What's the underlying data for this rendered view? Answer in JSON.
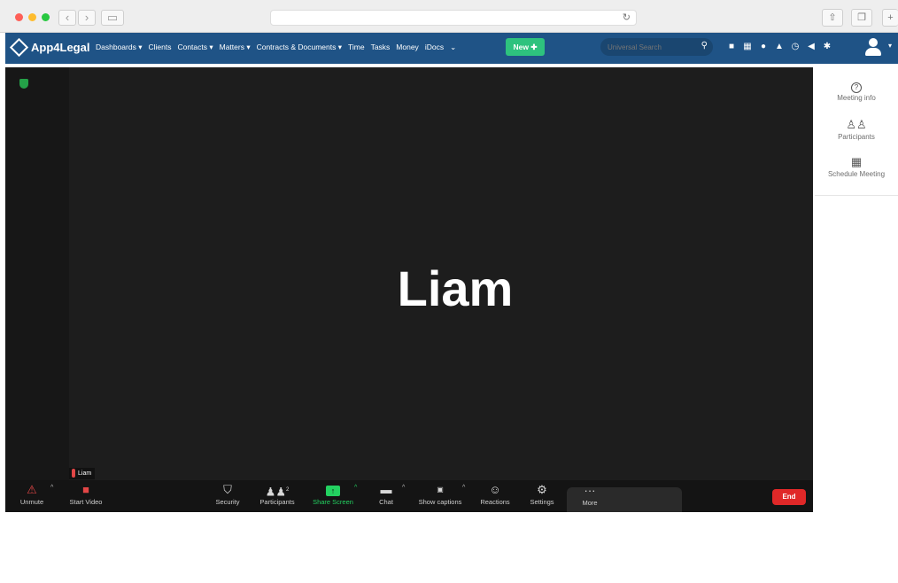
{
  "browser": {
    "icons": {
      "back": "chevron-left-icon",
      "forward": "chevron-right-icon",
      "sidebar": "sidebar-icon",
      "reload": "reload-icon",
      "share": "share-icon",
      "tabs": "tabs-icon",
      "new_tab": "plus-icon"
    }
  },
  "app": {
    "logo_text": "App4Legal",
    "menu": [
      "Dashboards ▾",
      "Clients",
      "Contacts ▾",
      "Matters ▾",
      "Contracts & Documents ▾",
      "Time",
      "Tasks",
      "Money",
      "iDocs",
      "⌄"
    ],
    "new_button": "New ✚",
    "search_placeholder": "Universal Search",
    "brand_color": "#1f5386",
    "accent_color": "#2ec27e"
  },
  "meeting": {
    "participant_name": "Liam",
    "name_tag": "Liam",
    "toolbar": {
      "unmute": "Unmute",
      "start_video": "Start Video",
      "security": "Security",
      "participants": "Participants",
      "participant_count": "2",
      "share_screen": "Share Screen",
      "chat": "Chat",
      "show_captions": "Show captions",
      "reactions": "Reactions",
      "settings": "Settings",
      "more": "More",
      "end": "End"
    },
    "end_color": "#e02828",
    "share_color": "#23d160"
  },
  "right_panel": {
    "meeting_info": "Meeting info",
    "participants": "Participants",
    "schedule_meeting": "Schedule Meeting"
  }
}
